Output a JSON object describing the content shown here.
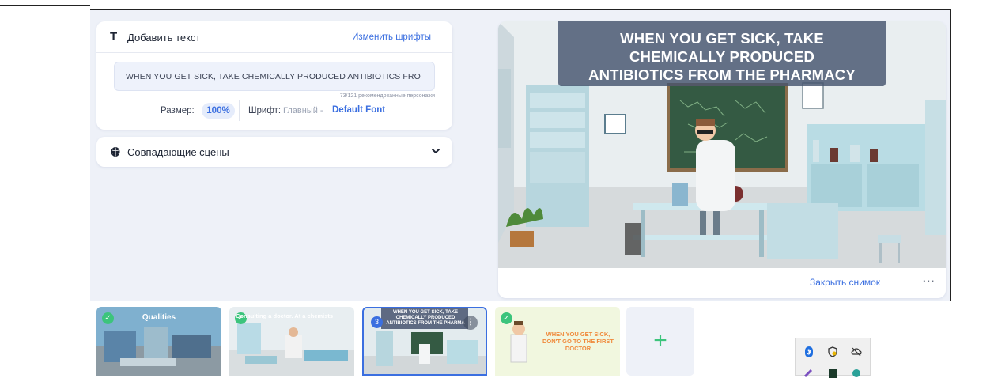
{
  "text_panel": {
    "title": "Добавить текст",
    "change_fonts_link": "Изменить шрифты",
    "text_value": "WHEN YOU GET SICK, TAKE CHEMICALLY PRODUCED ANTIBIOTICS FRO",
    "char_count": "73/121 рекомендованные персонажи",
    "size_label": "Размер:",
    "size_value": "100%",
    "font_label": "Шрифт:",
    "font_sub": "Главный -",
    "font_value": "Default Font"
  },
  "scenes_panel": {
    "label": "Совпадающие сцены"
  },
  "preview": {
    "caption_line1": "WHEN YOU GET SICK, TAKE",
    "caption_line2": "CHEMICALLY PRODUCED",
    "caption_line3": "ANTIBIOTICS FROM THE PHARMACY",
    "close_label": "Закрыть снимок",
    "more_label": "···"
  },
  "timeline": {
    "scenes": [
      {
        "title": "Qualities",
        "done": true
      },
      {
        "title": "Consulting a doctor. At a chemists",
        "done": true
      },
      {
        "title": "WHEN YOU GET SICK, TAKE CHEMICALLY PRODUCED ANTIBIOTICS FROM THE PHARMA",
        "number": "3",
        "selected": true
      },
      {
        "title": "WHEN YOU GET SICK, DON'T GO TO THE FIRST DOCTOR",
        "done": true
      }
    ],
    "add_label": "+"
  },
  "icons": {
    "text": "text-icon",
    "brain": "brain-icon",
    "chevron": "chevron-down-icon",
    "check": "check-icon",
    "add": "plus-icon"
  },
  "colors": {
    "accent": "#3b6fe0",
    "success": "#3cc47c",
    "panel_bg": "#eef1f8"
  }
}
